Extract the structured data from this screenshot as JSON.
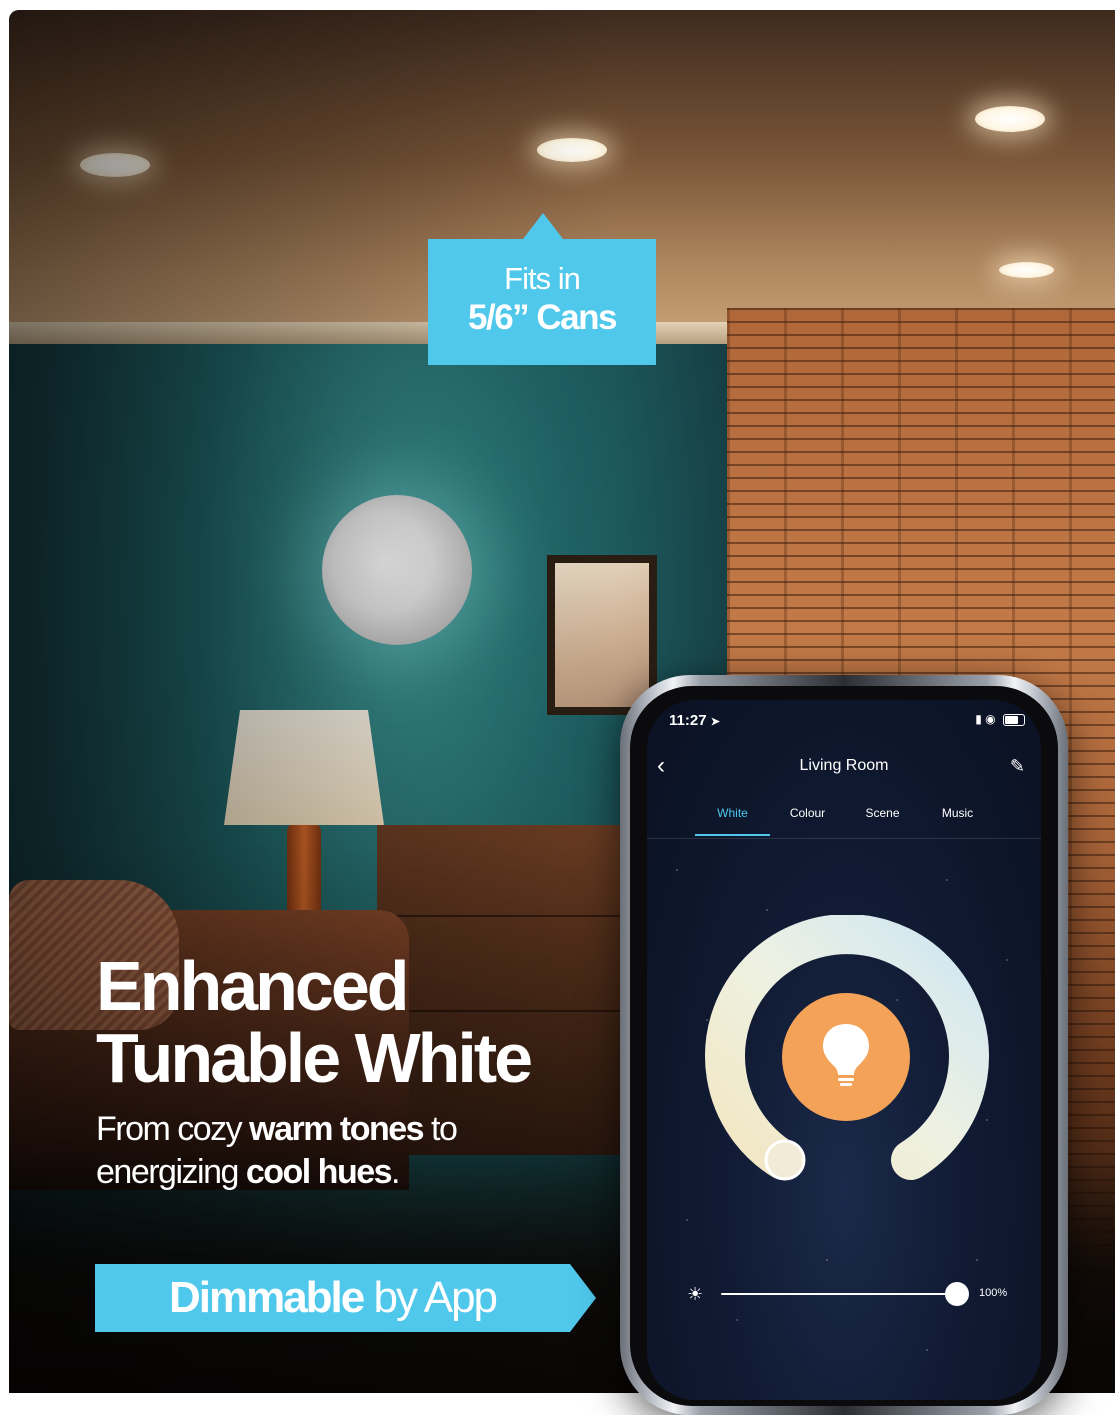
{
  "callout": {
    "line1": "Fits in",
    "line2": "5/6” Cans"
  },
  "headline": {
    "title_line1": "Enhanced",
    "title_line2": "Tunable White",
    "sub_part1": "From cozy ",
    "sub_bold1": "warm tones",
    "sub_part2": " to",
    "sub_part3": "energizing ",
    "sub_bold2": "cool hues",
    "sub_part4": "."
  },
  "banner": {
    "bold": "Dimmable",
    "rest": " by App"
  },
  "phone": {
    "status_time": "11:27",
    "room_title": "Living Room",
    "tabs": [
      {
        "label": "White",
        "active": true
      },
      {
        "label": "Colour",
        "active": false
      },
      {
        "label": "Scene",
        "active": false
      },
      {
        "label": "Music",
        "active": false
      }
    ],
    "brightness_label": "100%",
    "brightness_value": 100,
    "colors": {
      "accent": "#4fc8ec",
      "bulb": "#f4a257",
      "warm": "#f2e6c2",
      "cool": "#cfe6f3"
    }
  },
  "icons": {
    "back": "chevron-left-icon",
    "edit": "pencil-icon",
    "bulb": "lightbulb-icon",
    "sun": "sun-icon",
    "signal": "signal-icon",
    "wifi": "wifi-icon",
    "battery": "battery-icon",
    "location": "location-arrow-icon"
  }
}
